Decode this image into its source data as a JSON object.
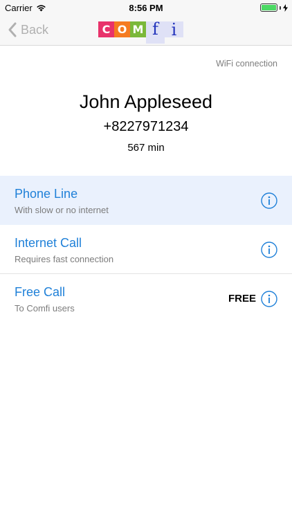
{
  "status_bar": {
    "carrier": "Carrier",
    "time": "8:56 PM"
  },
  "nav": {
    "back_label": "Back",
    "logo_letters": [
      "C",
      "O",
      "M",
      "f",
      "i"
    ],
    "logo_colors": [
      "#e8336b",
      "#f57b20",
      "#7bb83a",
      "#dfe1f6",
      "#dfe1f6"
    ]
  },
  "connection": {
    "label": "WiFi connection"
  },
  "contact": {
    "name": "John Appleseed",
    "phone": "+8227971234",
    "minutes": "567 min"
  },
  "options": [
    {
      "title": "Phone Line",
      "subtitle": "With slow or no internet",
      "price": "",
      "selected": true
    },
    {
      "title": "Internet Call",
      "subtitle": "Requires fast connection",
      "price": "",
      "selected": false
    },
    {
      "title": "Free Call",
      "subtitle": "To Comfi users",
      "price": "FREE",
      "selected": false
    }
  ],
  "colors": {
    "accent": "#1f80d8",
    "selected_row": "#eaf1fd",
    "battery": "#4cd964"
  },
  "icons": {
    "wifi": "wifi-icon",
    "info": "info-icon",
    "back": "chevron-left-icon"
  }
}
